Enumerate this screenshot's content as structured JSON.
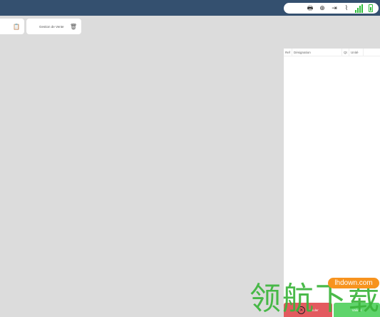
{
  "topbar": {
    "icons": [
      "printer-icon",
      "globe-icon",
      "logout-icon",
      "usb-icon",
      "signal-icon",
      "battery-icon"
    ],
    "glyphs": {
      "printer": "🖶",
      "globe": "⊕",
      "logout": "⇥",
      "usb": "⌇"
    }
  },
  "tabs": [
    {
      "label": "",
      "icon": "clipboard-icon",
      "glyph": "📋"
    },
    {
      "label": "Gestion de Vente",
      "icon": "trash-icon",
      "glyph": "🗑"
    }
  ],
  "order_panel": {
    "columns": [
      "Ref",
      "Désignation",
      "Qt",
      "Unité"
    ]
  },
  "buttons": {
    "cancel": {
      "label": "Annuler",
      "glyph": "✕"
    },
    "validate": {
      "label": "Valider"
    }
  },
  "watermark": {
    "site": "lhdown.com",
    "text": "领航下载"
  },
  "colors": {
    "topbar": "#34506f",
    "background": "#dcdcdc",
    "cancel": "#e35a5f",
    "validate": "#5fd46b",
    "signal": "#2ebd3a"
  }
}
